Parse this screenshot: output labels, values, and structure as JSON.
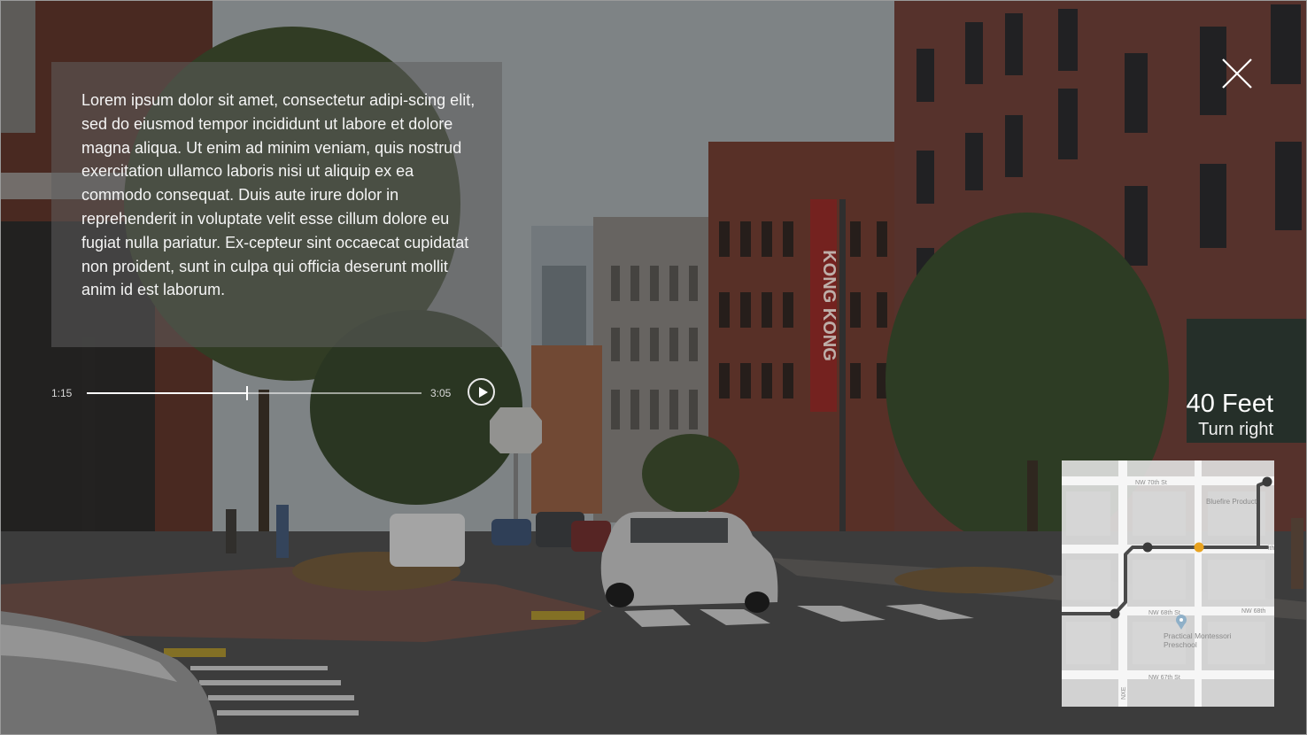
{
  "overlay_text": "Lorem ipsum dolor sit amet, consectetur adipi-scing elit, sed do eiusmod tempor incididunt ut labore et dolore magna aliqua. Ut enim ad minim veniam, quis nostrud exercitation ullamco laboris nisi ut aliquip ex ea commodo consequat. Duis aute irure dolor in reprehenderit in voluptate velit esse cillum dolore eu fugiat nulla pariatur. Ex-cepteur sint occaecat cupidatat non proident, sunt in culpa qui officia deserunt mollit anim id est laborum.",
  "scene_sign": "KONG KONG",
  "player": {
    "current_time": "1:15",
    "total_time": "3:05",
    "progress": 0.48,
    "play_icon": "play-icon"
  },
  "close_icon": "close-icon",
  "navigation": {
    "distance": "40 Feet",
    "instruction": "Turn right"
  },
  "map": {
    "labels": {
      "street_top": "NW 70th St",
      "poi_top": "Bluefire Product",
      "street_mid_left": "NW 68th St",
      "street_mid_right": "NW 68th",
      "street_bottom": "NW 67th St",
      "poi": "Practical Montessori Preschool",
      "vertical": "NXE",
      "right_edge": "ith"
    },
    "route_color": "#4a4a4a",
    "current_marker_color": "#e8a21f"
  },
  "colors": {
    "overlay_panel": "rgba(95,95,95,0.55)",
    "text": "#f4f4f4"
  }
}
